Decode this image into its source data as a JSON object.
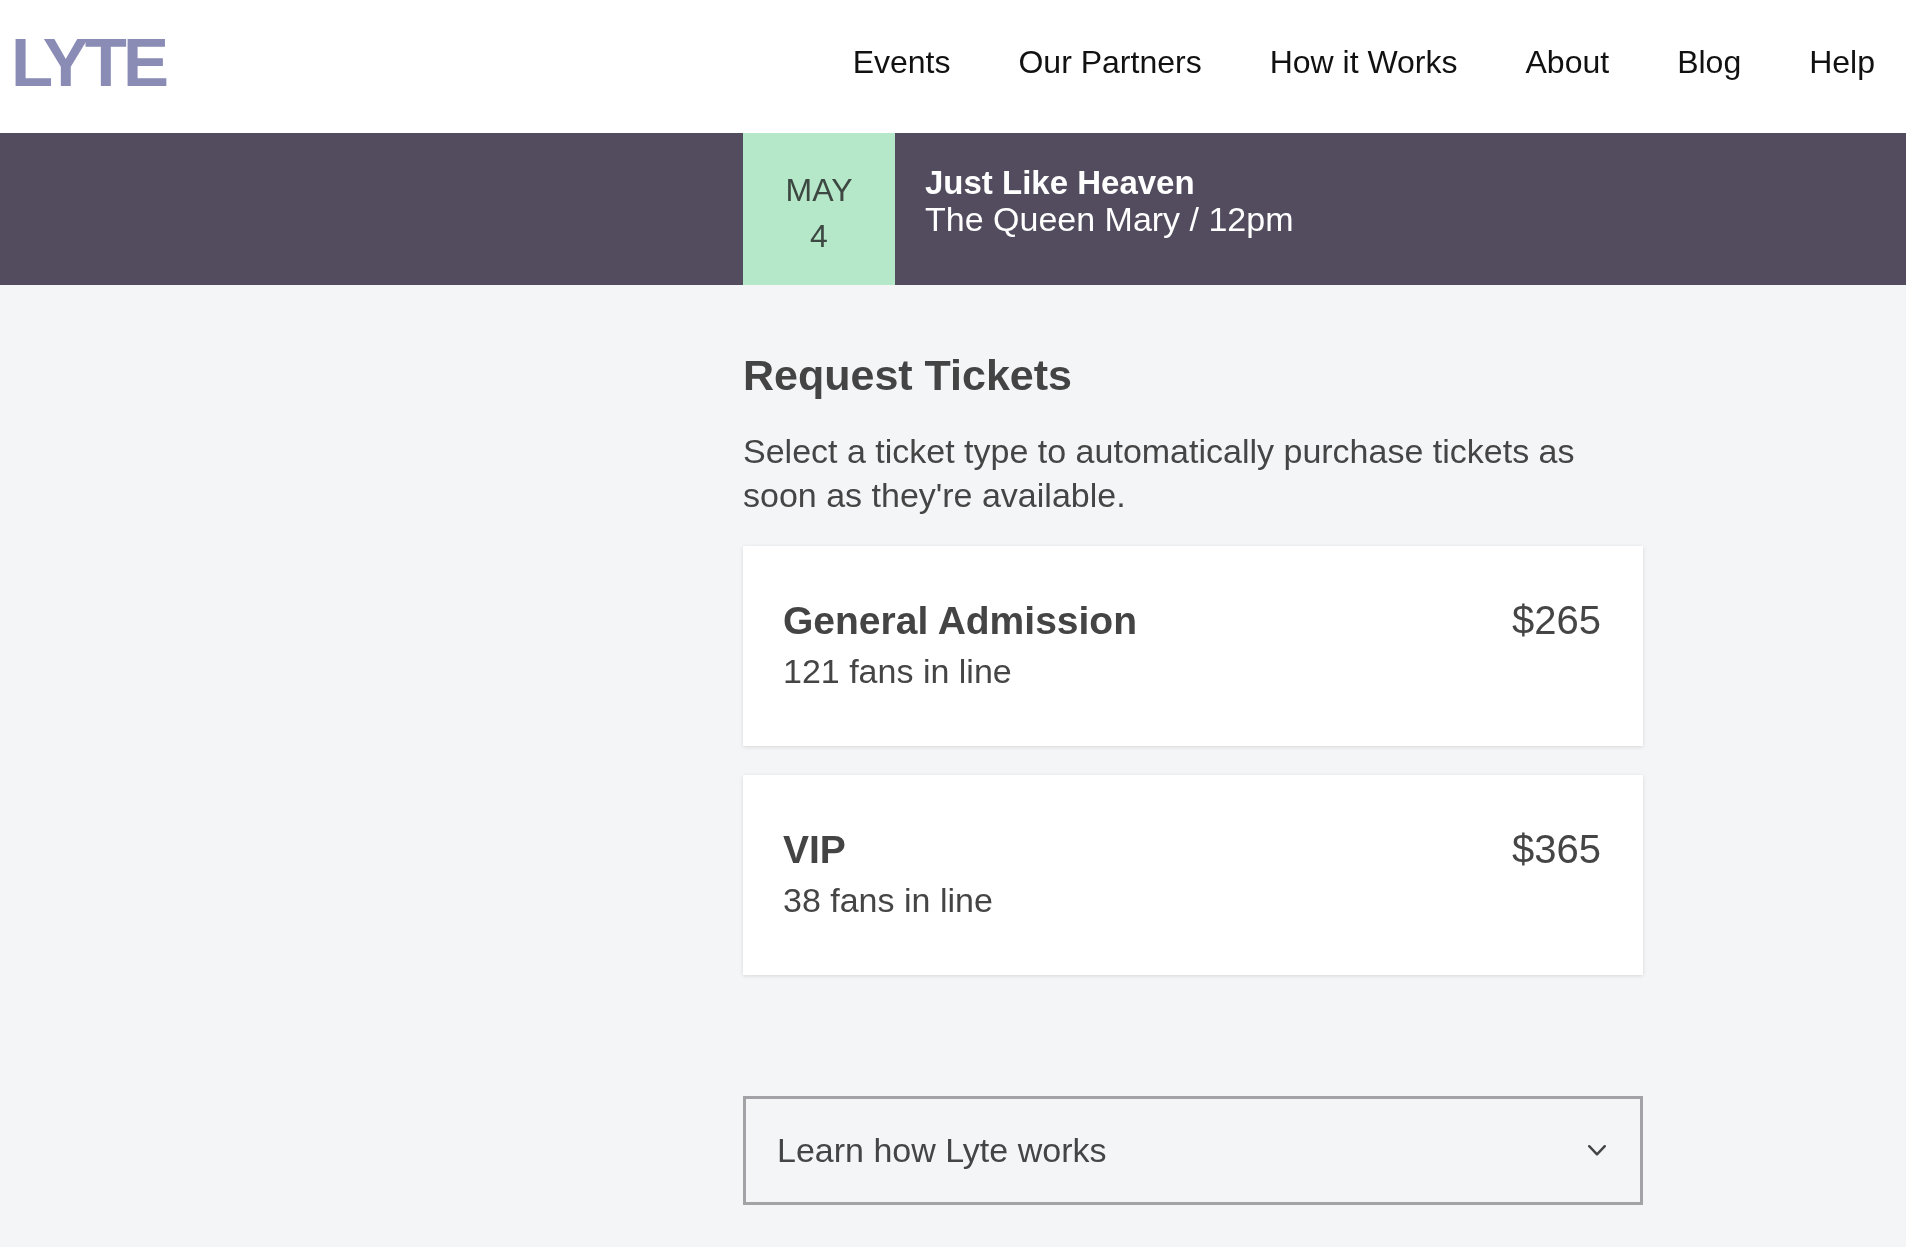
{
  "header": {
    "logo": "LYTE",
    "nav": [
      "Events",
      "Our Partners",
      "How it Works",
      "About",
      "Blog",
      "Help"
    ]
  },
  "event_banner": {
    "month": "MAY",
    "day": "4",
    "title": "Just Like Heaven",
    "details": "The Queen Mary / 12pm"
  },
  "request_tickets": {
    "heading": "Request Tickets",
    "description": "Select a ticket type to automatically purchase tickets as soon as they're available.",
    "ticket_types": [
      {
        "name": "General Admission",
        "queue": "121 fans in line",
        "price": "$265"
      },
      {
        "name": "VIP",
        "queue": "38 fans in line",
        "price": "$365"
      }
    ]
  },
  "accordion": {
    "label": "Learn how Lyte works",
    "expanded": false
  }
}
